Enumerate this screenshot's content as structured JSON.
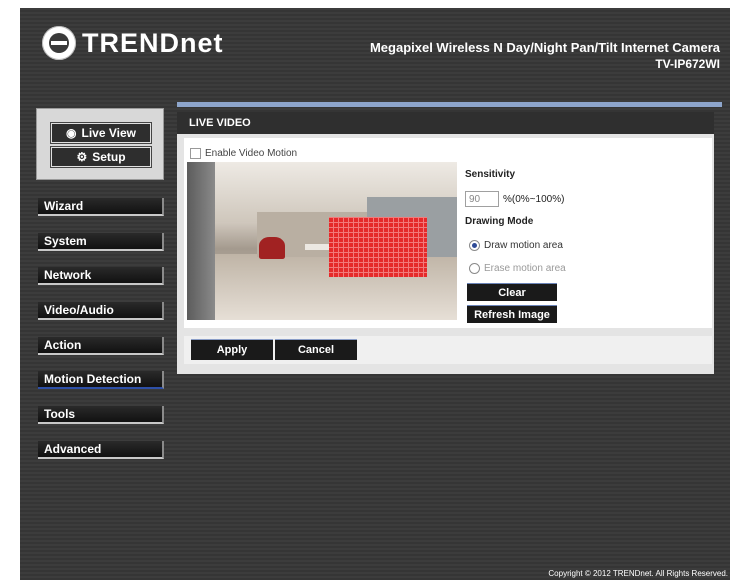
{
  "header": {
    "brand": "TRENDnet",
    "product_name": "Megapixel Wireless N Day/Night Pan/Tilt Internet Camera",
    "model": "TV-IP672WI"
  },
  "mode_buttons": {
    "live_view": {
      "label": "Live View",
      "icon": "eye-icon"
    },
    "setup": {
      "label": "Setup",
      "icon": "gear-icon"
    }
  },
  "nav": {
    "items": [
      {
        "label": "Wizard",
        "active": false
      },
      {
        "label": "System",
        "active": false
      },
      {
        "label": "Network",
        "active": false
      },
      {
        "label": "Video/Audio",
        "active": false
      },
      {
        "label": "Action",
        "active": false
      },
      {
        "label": "Motion Detection",
        "active": true
      },
      {
        "label": "Tools",
        "active": false
      },
      {
        "label": "Advanced",
        "active": false
      }
    ]
  },
  "panel": {
    "title": "LIVE VIDEO",
    "enable_label": "Enable Video Motion",
    "enable_checked": false,
    "sensitivity_label": "Sensitivity",
    "sensitivity_value": "90",
    "sensitivity_range": "%(0%~100%)",
    "drawing_mode_label": "Drawing Mode",
    "draw_label": "Draw motion area",
    "erase_label": "Erase motion area",
    "selected_mode": "draw",
    "clear_label": "Clear",
    "refresh_label": "Refresh Image"
  },
  "actions": {
    "apply_label": "Apply",
    "cancel_label": "Cancel"
  },
  "footer": {
    "copyright": "Copyright © 2012 TRENDnet. All Rights Reserved."
  },
  "colors": {
    "accent_blue": "#8ea6cc",
    "motion_red": "#e52a2a",
    "active_underline": "#2e50a8"
  }
}
